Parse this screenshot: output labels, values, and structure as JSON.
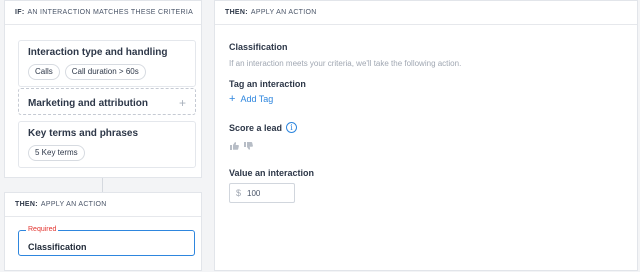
{
  "if_panel": {
    "header_bold": "IF:",
    "header_text": "AN INTERACTION MATCHES THESE CRITERIA",
    "criteria": [
      {
        "title": "Interaction type and handling",
        "chips": [
          "Calls",
          "Call duration > 60s"
        ]
      },
      {
        "title": "Marketing and attribution",
        "chips": []
      },
      {
        "title": "Key terms and phrases",
        "chips": [
          "5 Key terms"
        ]
      }
    ]
  },
  "then_left": {
    "header_bold": "THEN:",
    "header_text": "APPLY AN ACTION",
    "required_label": "Required",
    "value": "Classification"
  },
  "then_right": {
    "header_bold": "THEN:",
    "header_text": "APPLY AN ACTION",
    "title": "Classification",
    "subtitle": "If an interaction meets your criteria, we'll take the following action.",
    "tag_label": "Tag an interaction",
    "add_tag": "Add Tag",
    "score_label": "Score a lead",
    "value_label": "Value an interaction",
    "currency_symbol": "$",
    "value": "100"
  },
  "colors": {
    "accent": "#2e86de",
    "required": "#e3342f"
  }
}
